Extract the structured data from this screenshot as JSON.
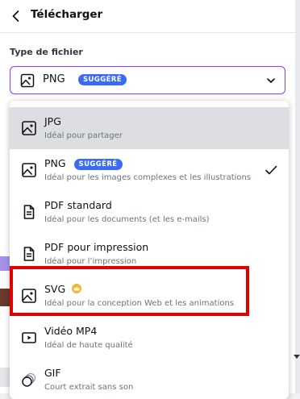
{
  "header": {
    "title": "Télécharger"
  },
  "file_type": {
    "label": "Type de fichier",
    "selected": "PNG",
    "selected_badge": "SUGGÉRÉ"
  },
  "options": [
    {
      "title": "JPG",
      "desc": "Idéal pour partager",
      "icon": "image-icon"
    },
    {
      "title": "PNG",
      "badge": "SUGGÉRÉ",
      "desc": "Idéal pour les images complexes et les illustrations",
      "icon": "image-icon",
      "checked": true
    },
    {
      "title": "PDF standard",
      "desc": "Idéal pour les documents (et les e-mails)",
      "icon": "document-icon"
    },
    {
      "title": "PDF pour impression",
      "desc": "Idéal pour l’impression",
      "icon": "document-icon"
    },
    {
      "title": "SVG",
      "desc": "Idéal pour la conception Web et les animations",
      "icon": "image-icon",
      "premium": true
    },
    {
      "title": "Vidéo MP4",
      "desc": "Idéal de haute qualité",
      "icon": "video-icon"
    },
    {
      "title": "GIF",
      "desc": "Court extrait sans son",
      "icon": "gif-icon"
    }
  ],
  "colors": {
    "accent": "#8b3dff",
    "badge": "#3b6bf6",
    "highlight": "#e30000",
    "crown": "#f5b625",
    "hover": "#dcdee2"
  }
}
